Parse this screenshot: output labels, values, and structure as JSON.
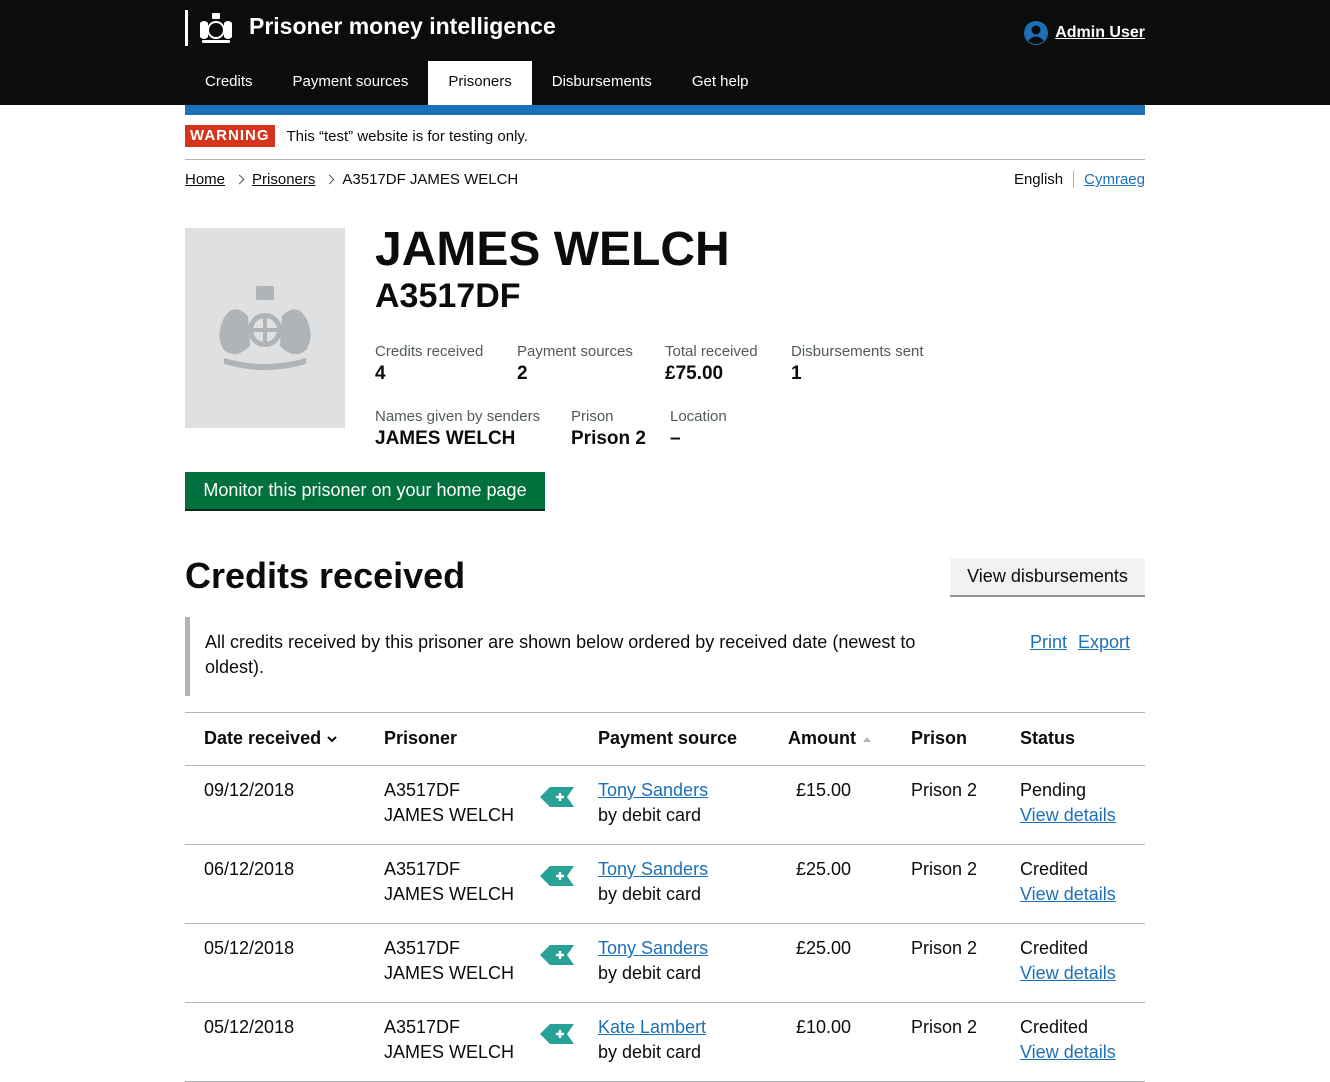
{
  "header": {
    "service_name": "Prisoner money intelligence",
    "user_name": "Admin User",
    "nav": [
      {
        "label": "Credits",
        "active": false
      },
      {
        "label": "Payment sources",
        "active": false
      },
      {
        "label": "Prisoners",
        "active": true
      },
      {
        "label": "Disbursements",
        "active": false
      },
      {
        "label": "Get help",
        "active": false
      }
    ]
  },
  "phase": {
    "tag": "WARNING",
    "text": "This “test” website is for testing only."
  },
  "breadcrumb": {
    "home": "Home",
    "prisoners": "Prisoners",
    "current": "A3517DF JAMES WELCH"
  },
  "language": {
    "current": "English",
    "other": "Cymraeg"
  },
  "prisoner": {
    "name": "JAMES WELCH",
    "number": "A3517DF",
    "stats": {
      "credits_received": {
        "label": "Credits received",
        "value": "4"
      },
      "payment_sources": {
        "label": "Payment sources",
        "value": "2"
      },
      "total_received": {
        "label": "Total received",
        "value": "£75.00"
      },
      "disbursements_sent": {
        "label": "Disbursements sent",
        "value": "1"
      },
      "names_given": {
        "label": "Names given by senders",
        "value": "JAMES WELCH"
      },
      "prison": {
        "label": "Prison",
        "value": "Prison 2"
      },
      "location": {
        "label": "Location",
        "value": "–"
      }
    },
    "monitor_button": "Monitor this prisoner on your home page"
  },
  "credits": {
    "title": "Credits received",
    "view_disbursements": "View disbursements",
    "description": "All credits received by this prisoner are shown below ordered by received date (newest to oldest).",
    "print": "Print",
    "export": "Export",
    "columns": {
      "date": "Date received",
      "prisoner": "Prisoner",
      "source": "Payment source",
      "amount": "Amount",
      "prison": "Prison",
      "status": "Status"
    },
    "rows": [
      {
        "date": "09/12/2018",
        "number": "A3517DF",
        "name": "JAMES WELCH",
        "sender": "Tony Sanders",
        "method": "by debit card",
        "amount": "£15.00",
        "prison": "Prison 2",
        "status": "Pending",
        "details": "View details"
      },
      {
        "date": "06/12/2018",
        "number": "A3517DF",
        "name": "JAMES WELCH",
        "sender": "Tony Sanders",
        "method": "by debit card",
        "amount": "£25.00",
        "prison": "Prison 2",
        "status": "Credited",
        "details": "View details"
      },
      {
        "date": "05/12/2018",
        "number": "A3517DF",
        "name": "JAMES WELCH",
        "sender": "Tony Sanders",
        "method": "by debit card",
        "amount": "£25.00",
        "prison": "Prison 2",
        "status": "Credited",
        "details": "View details"
      },
      {
        "date": "05/12/2018",
        "number": "A3517DF",
        "name": "JAMES WELCH",
        "sender": "Kate Lambert",
        "method": "by debit card",
        "amount": "£10.00",
        "prison": "Prison 2",
        "status": "Credited",
        "details": "View details"
      }
    ]
  },
  "colors": {
    "header_bg": "#0b0c0c",
    "link": "#1d70b8",
    "warning": "#d4351c",
    "start_button": "#00703c",
    "tag": "#28a197"
  }
}
